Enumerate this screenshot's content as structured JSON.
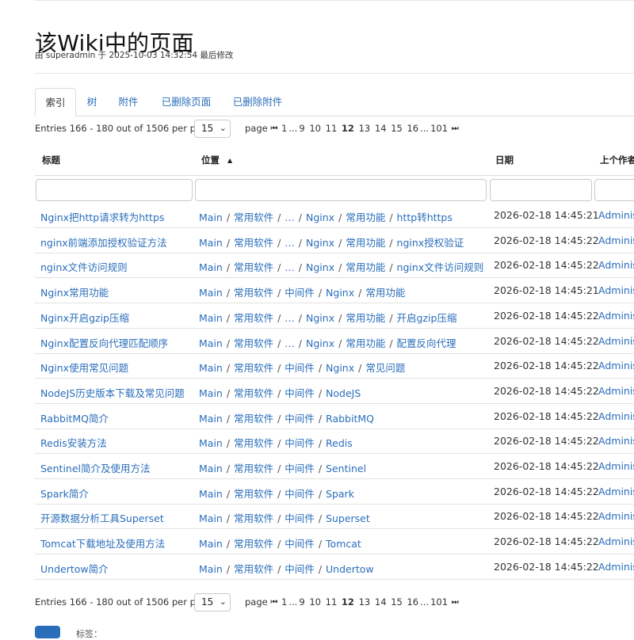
{
  "page": {
    "title": "该Wiki中的页面",
    "meta": {
      "prefix": "由 ",
      "user": "superadmin",
      "at": " 于 ",
      "time": "2025-10-03 14:32:54",
      "suffix": " 最后修改"
    }
  },
  "tabs": [
    {
      "label": "索引",
      "active": true
    },
    {
      "label": "树",
      "active": false
    },
    {
      "label": "附件",
      "active": false
    },
    {
      "label": "已删除页面",
      "active": false
    },
    {
      "label": "已删除附件",
      "active": false
    }
  ],
  "pagination": {
    "entries_text": "Entries 166 - 180 out of 1506 per page of",
    "per_page": "15",
    "page_label": "page",
    "pages": [
      "1",
      "...",
      "9",
      "10",
      "11",
      "12",
      "13",
      "14",
      "15",
      "16",
      "...",
      "101"
    ],
    "current_page": "12"
  },
  "table": {
    "columns": {
      "title": "标题",
      "location": "位置",
      "date": "日期",
      "author": "上个作者"
    },
    "rows": [
      {
        "title": "Nginx把http请求转为https",
        "location": [
          "Main",
          "常用软件",
          "…",
          "Nginx",
          "常用功能",
          "http转https"
        ],
        "date": "2026-02-18 14:45:21",
        "author": "Administrator"
      },
      {
        "title": "nginx前端添加授权验证方法",
        "location": [
          "Main",
          "常用软件",
          "…",
          "Nginx",
          "常用功能",
          "nginx授权验证"
        ],
        "date": "2026-02-18 14:45:22",
        "author": "Administrator"
      },
      {
        "title": "nginx文件访问规则",
        "location": [
          "Main",
          "常用软件",
          "…",
          "Nginx",
          "常用功能",
          "nginx文件访问规则"
        ],
        "date": "2026-02-18 14:45:22",
        "author": "Administrator"
      },
      {
        "title": "Nginx常用功能",
        "location": [
          "Main",
          "常用软件",
          "中间件",
          "Nginx",
          "常用功能"
        ],
        "date": "2026-02-18 14:45:21",
        "author": "Administrator"
      },
      {
        "title": "Nginx开启gzip压缩",
        "location": [
          "Main",
          "常用软件",
          "…",
          "Nginx",
          "常用功能",
          "开启gzip压缩"
        ],
        "date": "2026-02-18 14:45:22",
        "author": "Administrator"
      },
      {
        "title": "Nginx配置反向代理匹配顺序",
        "location": [
          "Main",
          "常用软件",
          "…",
          "Nginx",
          "常用功能",
          "配置反向代理"
        ],
        "date": "2026-02-18 14:45:22",
        "author": "Administrator"
      },
      {
        "title": "Nginx使用常见问题",
        "location": [
          "Main",
          "常用软件",
          "中间件",
          "Nginx",
          "常见问题"
        ],
        "date": "2026-02-18 14:45:22",
        "author": "Administrator"
      },
      {
        "title": "NodeJS历史版本下载及常见问题",
        "location": [
          "Main",
          "常用软件",
          "中间件",
          "NodeJS"
        ],
        "date": "2026-02-18 14:45:22",
        "author": "Administrator"
      },
      {
        "title": "RabbitMQ简介",
        "location": [
          "Main",
          "常用软件",
          "中间件",
          "RabbitMQ"
        ],
        "date": "2026-02-18 14:45:22",
        "author": "Administrator"
      },
      {
        "title": "Redis安装方法",
        "location": [
          "Main",
          "常用软件",
          "中间件",
          "Redis"
        ],
        "date": "2026-02-18 14:45:22",
        "author": "Administrator"
      },
      {
        "title": "Sentinel简介及使用方法",
        "location": [
          "Main",
          "常用软件",
          "中间件",
          "Sentinel"
        ],
        "date": "2026-02-18 14:45:22",
        "author": "Administrator"
      },
      {
        "title": "Spark简介",
        "location": [
          "Main",
          "常用软件",
          "中间件",
          "Spark"
        ],
        "date": "2026-02-18 14:45:22",
        "author": "Administrator"
      },
      {
        "title": "开源数据分析工具Superset",
        "location": [
          "Main",
          "常用软件",
          "中间件",
          "Superset"
        ],
        "date": "2026-02-18 14:45:22",
        "author": "Administrator"
      },
      {
        "title": "Tomcat下载地址及使用方法",
        "location": [
          "Main",
          "常用软件",
          "中间件",
          "Tomcat"
        ],
        "date": "2026-02-18 14:45:22",
        "author": "Administrator"
      },
      {
        "title": "Undertow简介",
        "location": [
          "Main",
          "常用软件",
          "中间件",
          "Undertow"
        ],
        "date": "2026-02-18 14:45:22",
        "author": "Administrator"
      }
    ]
  },
  "footer": {
    "tags_label": "标签："
  },
  "icons": {
    "sort": "sort-asc-icon",
    "first": "first-page-icon",
    "last": "last-page-icon",
    "select": "chevron-down-icon"
  },
  "colors": {
    "link": "#2a6ebb",
    "text": "#222222",
    "border": "#dddddd"
  }
}
